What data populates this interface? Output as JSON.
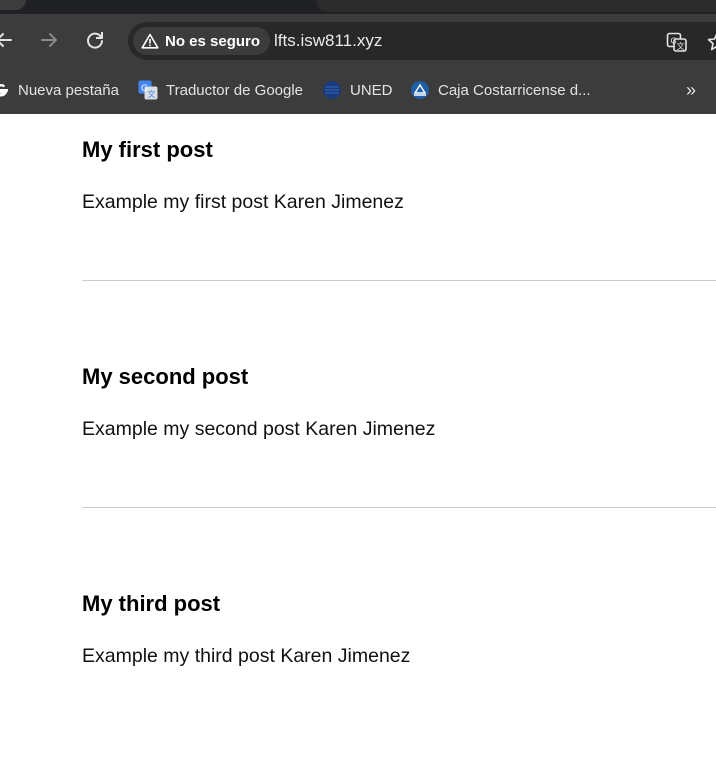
{
  "browser": {
    "security_chip": "No es seguro",
    "url": "lfts.isw811.xyz",
    "bookmarks": [
      {
        "label": "Nueva pestaña",
        "icon": "google-icon"
      },
      {
        "label": "Traductor de Google",
        "icon": "google-translate-icon"
      },
      {
        "label": "UNED",
        "icon": "uned-icon"
      },
      {
        "label": "Caja Costarricense d...",
        "icon": "ccss-icon"
      }
    ],
    "more_bookmarks": "»"
  },
  "posts": [
    {
      "title": "My first post",
      "body": "Example my first post Karen Jimenez"
    },
    {
      "title": "My second post",
      "body": "Example my second post Karen Jimenez"
    },
    {
      "title": "My third post",
      "body": "Example my third post Karen Jimenez"
    }
  ],
  "colors": {
    "chrome": "#3c3c3c",
    "omnibox": "#282828",
    "divider": "#cccccc"
  }
}
